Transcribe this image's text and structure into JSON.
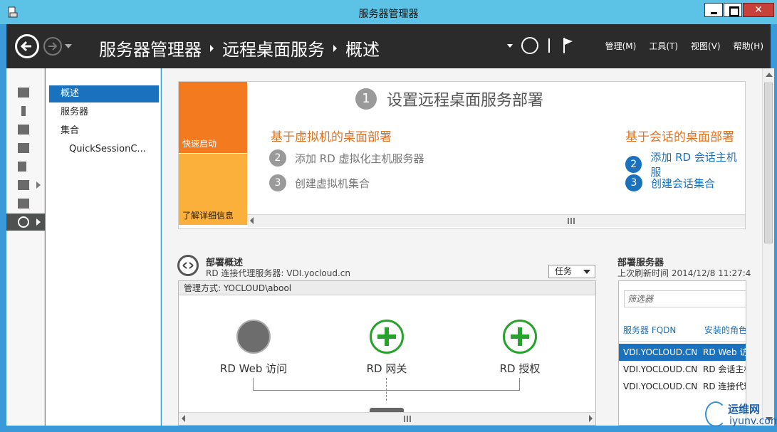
{
  "window": {
    "title": "服务器管理器",
    "close_label": "✕"
  },
  "header": {
    "breadcrumb": [
      "服务器管理器",
      "远程桌面服务",
      "概述"
    ],
    "menus": [
      "管理(M)",
      "工具(T)",
      "视图(V)",
      "帮助(H)"
    ]
  },
  "rail": {
    "icons": [
      "dashboard-icon",
      "local-server-icon",
      "all-servers-icon",
      "file-storage-icon",
      "iis-icon",
      "remote-access-icon",
      "print-icon",
      "remote-desktop-icon"
    ],
    "active_index": 7
  },
  "nav": {
    "items": [
      {
        "label": "概述",
        "active": true
      },
      {
        "label": "服务器",
        "active": false
      },
      {
        "label": "集合",
        "active": false
      },
      {
        "label": "QuickSessionC...",
        "active": false
      }
    ]
  },
  "quick_start": {
    "tile_quick": "快速启动",
    "tile_learn": "了解详细信息",
    "step1_num": "1",
    "step1_text": "设置远程桌面服务部署",
    "vm_title": "基于虚拟机的桌面部署",
    "vm_steps": [
      {
        "num": "2",
        "text": "添加 RD 虚拟化主机服务器"
      },
      {
        "num": "3",
        "text": "创建虚拟机集合"
      }
    ],
    "session_title": "基于会话的桌面部署",
    "session_steps": [
      {
        "num": "2",
        "text": "添加 RD 会话主机服"
      },
      {
        "num": "3",
        "text": "创建会话集合"
      }
    ]
  },
  "deployment": {
    "title": "部署概述",
    "broker": "RD 连接代理服务器: VDI.yocloud.cn",
    "tasks_label": "任务",
    "managed_by": "管理方式: YOCLOUD\\abool",
    "roles": [
      "RD Web 访问",
      "RD 网关",
      "RD 授权"
    ]
  },
  "servers": {
    "title": "部署服务器",
    "refreshed": "上次刷新时间 2014/12/8 11:27:4",
    "filter_placeholder": "筛选器",
    "columns": [
      "服务器 FQDN",
      "安装的角色"
    ],
    "rows": [
      {
        "fqdn": "VDI.YOCLOUD.CN",
        "role": "RD Web 访"
      },
      {
        "fqdn": "VDI.YOCLOUD.CN",
        "role": "RD 会话主机"
      },
      {
        "fqdn": "VDI.YOCLOUD.CN",
        "role": "RD 连接代理"
      }
    ]
  },
  "watermark": {
    "line1": "运维网",
    "line2": "iyunv.com"
  },
  "colors": {
    "accent": "#1a72be",
    "header": "#2b2b2b",
    "titlebar": "#5cc3e6",
    "orange": "#f37a1e",
    "yellow": "#fbb03b",
    "green": "#27a22d"
  }
}
